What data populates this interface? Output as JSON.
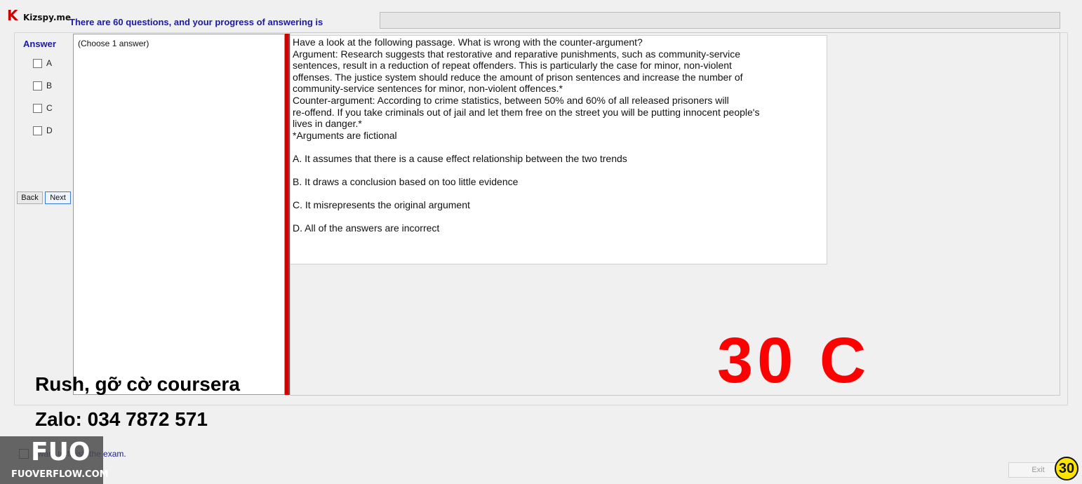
{
  "app": {
    "logo_letter": "K",
    "logo_text": "Kizspy.me"
  },
  "header": {
    "progress_text": "There are 60 questions, and your progress of answering is",
    "progress_fraction": 0
  },
  "answer_panel": {
    "title": "Answer",
    "options": [
      "A",
      "B",
      "C",
      "D"
    ],
    "back_label": "Back",
    "next_label": "Next"
  },
  "choose_panel": {
    "instruction": "(Choose 1 answer)"
  },
  "question": {
    "lines": [
      "Have a look at the following passage. What is wrong with the counter-argument?",
      "Argument: Research suggests that restorative and reparative punishments, such as community-service",
      "sentences, result in a reduction of repeat offenders. This is particularly the case for minor, non-violent",
      "offenses. The justice system should reduce the amount of prison sentences and increase the number of",
      "community-service sentences for minor, non-violent offences.*",
      "Counter-argument: According to crime statistics, between 50% and 60% of all released prisoners will",
      "re-offend. If you take criminals out of jail and let them free on the street you will be putting innocent people's",
      "lives in danger.*",
      "*Arguments are fictional"
    ],
    "options": [
      "A.  It assumes that there is a cause effect relationship between the two trends",
      "B.  It draws a conclusion based on too little evidence",
      "C.  It misrepresents the original argument",
      "D.  All of the answers are incorrect"
    ]
  },
  "overlay": {
    "answer_text": "30 C",
    "promo_line1": "Rush, gỡ cờ coursera",
    "promo_line2": "Zalo: 034 7872 571"
  },
  "footer": {
    "finish_text": "I want to finish the exam.",
    "exit_label": "Exit",
    "question_number": "30"
  },
  "watermark": {
    "logo": "FUO",
    "site": "FUOVERFLOW.COM"
  },
  "colors": {
    "accent_blue": "#1a1aa6",
    "red": "#d10000",
    "answer_red": "#ff0000",
    "badge_yellow": "#ffe400"
  }
}
